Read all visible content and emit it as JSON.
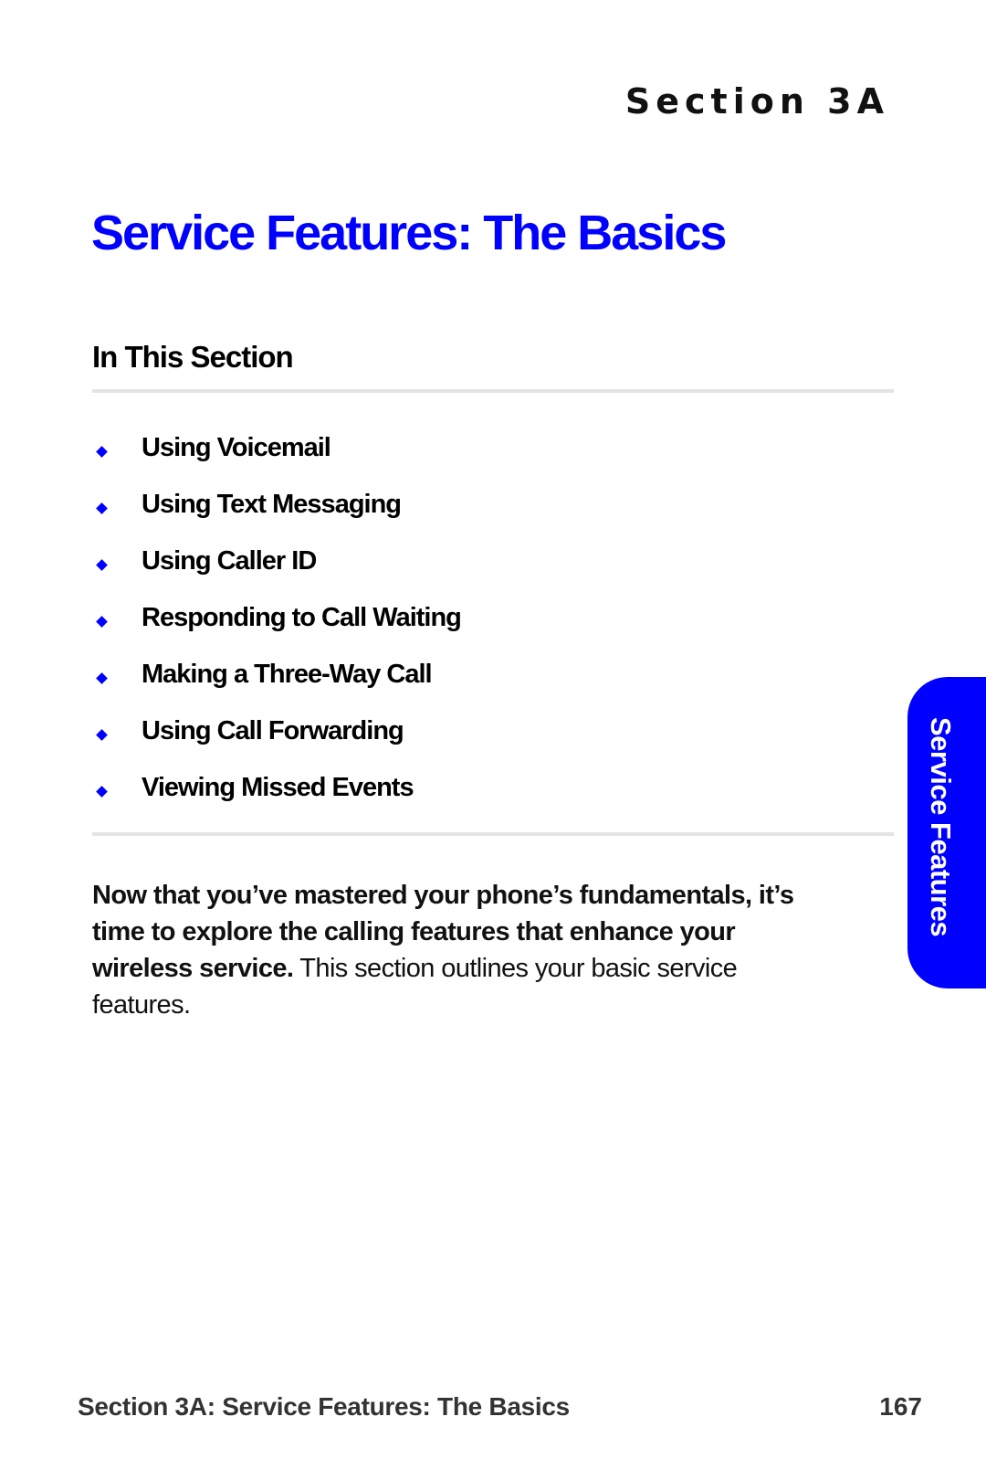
{
  "header": {
    "section_label": "Section 3A",
    "title": "Service Features: The Basics"
  },
  "in_this_section": {
    "heading": "In This Section",
    "bullet_icon": "diamond-bullet-icon",
    "items": [
      {
        "label": "Using Voicemail"
      },
      {
        "label": "Using Text Messaging"
      },
      {
        "label": "Using Caller ID"
      },
      {
        "label": "Responding to Call Waiting"
      },
      {
        "label": "Making a Three-Way Call"
      },
      {
        "label": "Using Call Forwarding"
      },
      {
        "label": "Viewing Missed Events"
      }
    ]
  },
  "intro": {
    "lead": "Now that you’ve mastered your phone’s fundamentals, it’s time to explore the calling features that enhance your wireless service.",
    "body": " This section outlines your basic service features."
  },
  "side_tab": {
    "label": "Service Features"
  },
  "footer": {
    "title": "Section 3A: Service Features: The Basics",
    "page_number": "167"
  },
  "colors": {
    "accent": "#0000ff",
    "divider": "#e3e3e3",
    "text": "#000000",
    "footer_text": "#333333"
  }
}
